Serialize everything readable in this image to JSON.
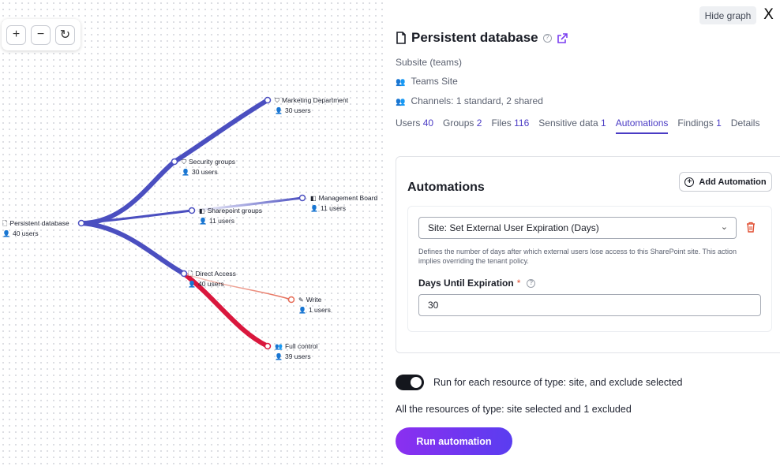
{
  "graph": {
    "zoom_in": "+",
    "zoom_out": "−",
    "reset": "↻",
    "nodes": {
      "root": {
        "name": "Persistent database",
        "count": "40 users"
      },
      "marketing": {
        "name": "Marketing Department",
        "count": "30 users"
      },
      "security": {
        "name": "Security groups",
        "count": "30 users"
      },
      "management": {
        "name": "Management Board",
        "count": "11 users"
      },
      "sharepoint": {
        "name": "Sharepoint groups",
        "count": "11 users"
      },
      "direct": {
        "name": "Direct Access",
        "count": "40 users"
      },
      "write": {
        "name": "Write",
        "count": "1 users"
      },
      "full": {
        "name": "Full control",
        "count": "39 users"
      }
    },
    "colors": {
      "edge_blue": "#4b4fc0",
      "edge_red": "#d9173d"
    }
  },
  "header": {
    "hide_graph": "Hide graph",
    "close": "X",
    "title": "Persistent database",
    "help": "?",
    "type": "Subsite (teams)",
    "site": "Teams Site",
    "channels": "Channels: 1 standard, 2 shared"
  },
  "tabs": [
    {
      "label": "Users",
      "count": "40"
    },
    {
      "label": "Groups",
      "count": "2"
    },
    {
      "label": "Files",
      "count": "116"
    },
    {
      "label": "Sensitive data",
      "count": "1"
    },
    {
      "label": "Automations",
      "count": ""
    },
    {
      "label": "Findings",
      "count": "1"
    },
    {
      "label": "Details",
      "count": ""
    }
  ],
  "automations": {
    "title": "Automations",
    "add_button": "Add Automation",
    "select_value": "Site: Set External User Expiration (Days)",
    "description": "Defines the number of days after which external users lose access to this SharePoint site. This action implies overriding the tenant policy.",
    "field_label": "Days Until Expiration",
    "required_mark": "*",
    "field_value": "30"
  },
  "run": {
    "toggle_label": "Run for each resource of type: site, and exclude selected",
    "summary": "All the resources of type: site selected and 1 excluded",
    "button": "Run automation"
  },
  "colors": {
    "accent": "#4a3bc4",
    "danger": "#e04c2f",
    "button_start": "#8b2ff0",
    "button_end": "#5a3df0"
  }
}
